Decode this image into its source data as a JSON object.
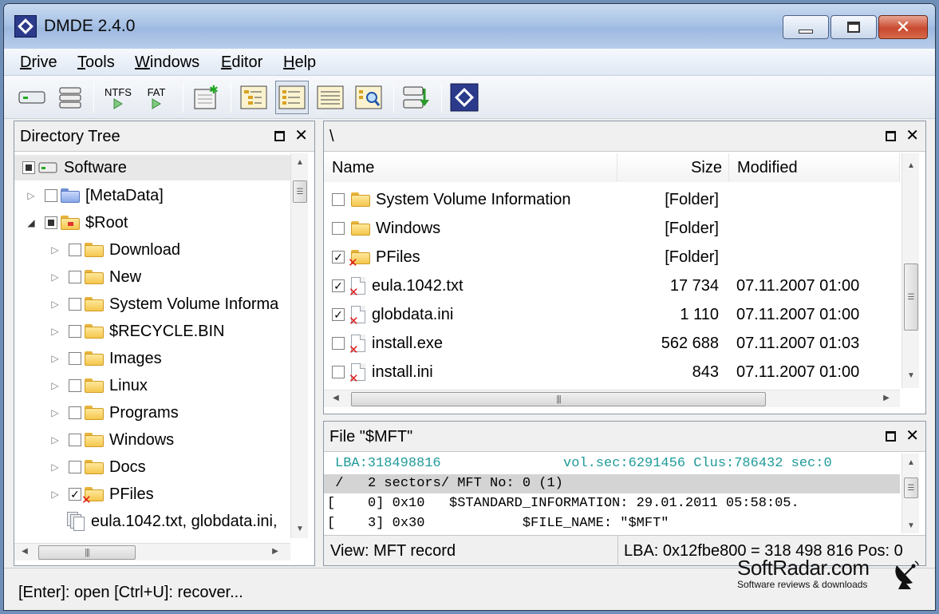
{
  "window": {
    "title": "DMDE 2.4.0"
  },
  "menu": [
    {
      "label": "Drive",
      "mnemonic": "D"
    },
    {
      "label": "Tools",
      "mnemonic": "T"
    },
    {
      "label": "Windows",
      "mnemonic": "W"
    },
    {
      "label": "Editor",
      "mnemonic": "E"
    },
    {
      "label": "Help",
      "mnemonic": "H"
    }
  ],
  "toolbar": {
    "ntfs_label": "NTFS",
    "fat_label": "FAT",
    "icons": [
      "drive-icon",
      "partitions-icon",
      "ntfs-search-icon",
      "fat-search-icon",
      "new-sector-icon",
      "tree-view-icon",
      "list-view-icon",
      "details-view-icon",
      "find-file-icon",
      "recover-icon",
      "dmde-icon"
    ]
  },
  "directory_tree": {
    "title": "Directory Tree",
    "root": "Software",
    "items": [
      {
        "label": "[MetaData]",
        "level": 1,
        "expander": "▷",
        "check": "none",
        "icon": "blue-folder-icon"
      },
      {
        "label": "$Root",
        "level": 1,
        "expander": "◢",
        "check": "partial",
        "icon": "root-folder-icon"
      },
      {
        "label": "Download",
        "level": 2,
        "expander": "▷",
        "check": "none",
        "icon": "folder-icon"
      },
      {
        "label": "New",
        "level": 2,
        "expander": "▷",
        "check": "none",
        "icon": "folder-icon"
      },
      {
        "label": "System Volume Informa",
        "level": 2,
        "expander": "▷",
        "check": "none",
        "icon": "folder-icon"
      },
      {
        "label": "$RECYCLE.BIN",
        "level": 2,
        "expander": "▷",
        "check": "none",
        "icon": "folder-icon"
      },
      {
        "label": "Images",
        "level": 2,
        "expander": "▷",
        "check": "none",
        "icon": "folder-icon"
      },
      {
        "label": "Linux",
        "level": 2,
        "expander": "▷",
        "check": "none",
        "icon": "folder-icon"
      },
      {
        "label": "Programs",
        "level": 2,
        "expander": "▷",
        "check": "none",
        "icon": "folder-icon"
      },
      {
        "label": "Windows",
        "level": 2,
        "expander": "▷",
        "check": "none",
        "icon": "folder-icon"
      },
      {
        "label": "Docs",
        "level": 2,
        "expander": "▷",
        "check": "none",
        "icon": "folder-icon"
      },
      {
        "label": "PFiles",
        "level": 2,
        "expander": "▷",
        "check": "checked",
        "icon": "deleted-folder-icon"
      }
    ],
    "files_summary": "eula.1042.txt, globdata.ini,"
  },
  "file_panel": {
    "path": "\\",
    "columns": {
      "name": "Name",
      "size": "Size",
      "modified": "Modified"
    },
    "rows": [
      {
        "name": "System Volume Information",
        "size": "[Folder]",
        "modified": "",
        "checked": false,
        "type": "folder"
      },
      {
        "name": "Windows",
        "size": "[Folder]",
        "modified": "",
        "checked": false,
        "type": "folder"
      },
      {
        "name": "PFiles",
        "size": "[Folder]",
        "modified": "",
        "checked": true,
        "type": "deleted-folder"
      },
      {
        "name": "eula.1042.txt",
        "size": "17 734",
        "modified": "07.11.2007 01:00",
        "checked": true,
        "type": "deleted-file"
      },
      {
        "name": "globdata.ini",
        "size": "1 110",
        "modified": "07.11.2007 01:00",
        "checked": true,
        "type": "deleted-file"
      },
      {
        "name": "install.exe",
        "size": "562 688",
        "modified": "07.11.2007 01:03",
        "checked": false,
        "type": "deleted-file"
      },
      {
        "name": "install.ini",
        "size": "843",
        "modified": "07.11.2007 01:00",
        "checked": false,
        "type": "deleted-file"
      }
    ]
  },
  "mft_panel": {
    "title": "File \"$MFT\"",
    "lba": "LBA:318498816",
    "vol": "vol.sec:6291456 Clus:786432 sec:0",
    "line1": " /   2 sectors/ MFT No: 0 (1)",
    "line2": "[    0] 0x10   $STANDARD_INFORMATION: 29.01.2011 05:58:05.",
    "line3": "[    3] 0x30            $FILE_NAME: \"$MFT\"",
    "view": "View: MFT record",
    "lba_info": "LBA: 0x12fbe800 = 318 498 816  Pos: 0"
  },
  "status": {
    "text": "[Enter]: open  [Ctrl+U]: recover..."
  },
  "watermark": {
    "title": "SoftRadar.com",
    "subtitle": "Software reviews & downloads"
  },
  "colors": {
    "teal_text": "#1f9a9a",
    "highlight_row": "#d4d4d4",
    "deleted_mark": "#e01818"
  }
}
